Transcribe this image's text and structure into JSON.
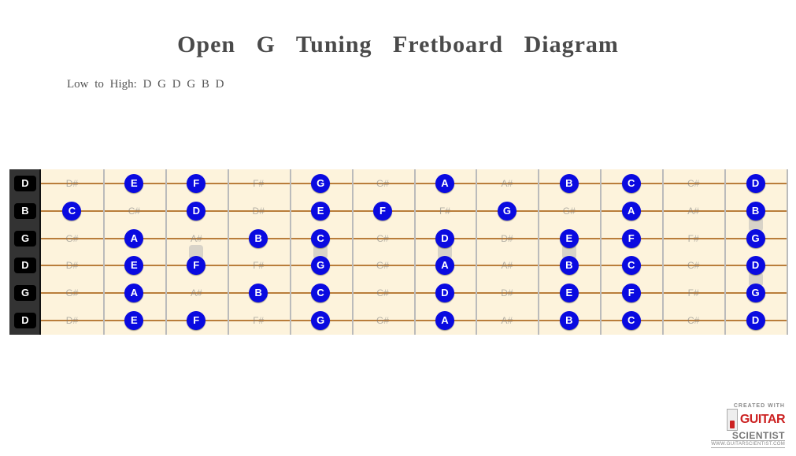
{
  "title": "Open  G Tuning   Fretboard    Diagram",
  "subtitle": "Low to High:  D G D G B D",
  "logo": {
    "created": "CREATED WITH",
    "brand1": "GUITAR",
    "brand2": "SCIENTIST",
    "url": "WWW.GUITARSCIENTIST.COM"
  },
  "chart_data": {
    "type": "table",
    "title": "Open G Tuning Fretboard Diagram",
    "tuning_low_to_high": [
      "D",
      "G",
      "D",
      "G",
      "B",
      "D"
    ],
    "frets": 12,
    "strings_high_to_low": [
      {
        "open": "D",
        "frets": [
          "D#",
          "E",
          "F",
          "F#",
          "G",
          "G#",
          "A",
          "A#",
          "B",
          "C",
          "C#",
          "D"
        ]
      },
      {
        "open": "B",
        "frets": [
          "C",
          "C#",
          "D",
          "D#",
          "E",
          "F",
          "F#",
          "G",
          "G#",
          "A",
          "A#",
          "B"
        ]
      },
      {
        "open": "G",
        "frets": [
          "G#",
          "A",
          "A#",
          "B",
          "C",
          "C#",
          "D",
          "D#",
          "E",
          "F",
          "F#",
          "G"
        ]
      },
      {
        "open": "D",
        "frets": [
          "D#",
          "E",
          "F",
          "F#",
          "G",
          "G#",
          "A",
          "A#",
          "B",
          "C",
          "C#",
          "D"
        ]
      },
      {
        "open": "G",
        "frets": [
          "G#",
          "A",
          "A#",
          "B",
          "C",
          "C#",
          "D",
          "D#",
          "E",
          "F",
          "F#",
          "G"
        ]
      },
      {
        "open": "D",
        "frets": [
          "D#",
          "E",
          "F",
          "F#",
          "G",
          "G#",
          "A",
          "A#",
          "B",
          "C",
          "C#",
          "D"
        ]
      }
    ],
    "highlighted_notes": [
      "A",
      "B",
      "C",
      "D",
      "E",
      "F",
      "G"
    ],
    "inlay_frets": [
      3,
      5,
      7,
      9,
      12
    ]
  }
}
